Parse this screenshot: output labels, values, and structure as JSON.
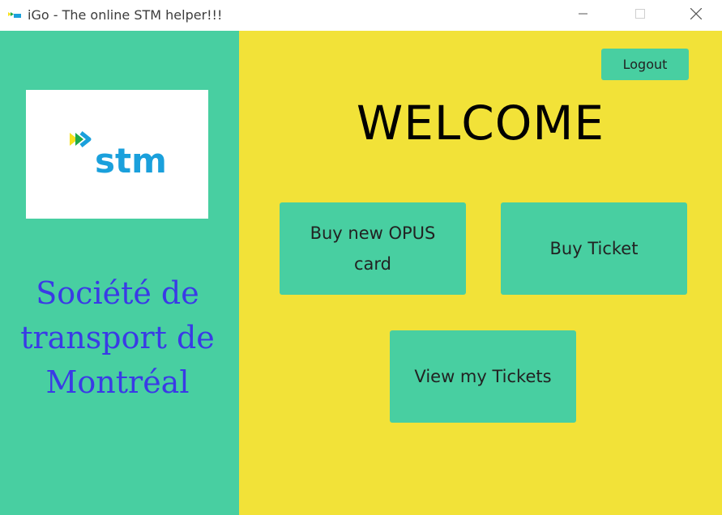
{
  "window": {
    "title": "iGo - The online STM helper!!!",
    "minimize_glyph": "—",
    "maximize_glyph": "☐",
    "close_glyph": "✕"
  },
  "sidebar": {
    "logo_text": "stm",
    "org_name_lines": [
      "Société de",
      "transport de",
      "Montréal"
    ]
  },
  "main": {
    "logout_label": "Logout",
    "welcome": "WELCOME",
    "buttons": {
      "buy_opus": "Buy new OPUS card",
      "buy_ticket": "Buy Ticket",
      "view_tickets": "View my Tickets"
    }
  },
  "colors": {
    "sidebar_bg": "#48cfa1",
    "main_bg": "#f2e238",
    "button_bg": "#48cfa1",
    "org_text": "#3a3ae6",
    "stm_blue": "#1aa0dc",
    "stm_yellow": "#f6e11c",
    "stm_green": "#1faa4b"
  }
}
